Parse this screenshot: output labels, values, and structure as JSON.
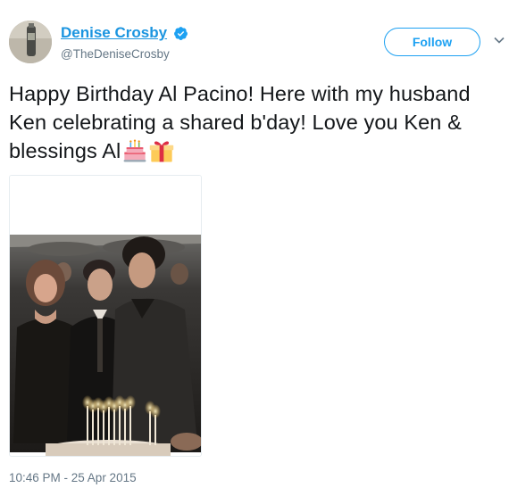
{
  "author": {
    "name": "Denise Crosby",
    "handle": "@TheDeniseCrosby",
    "verified": true
  },
  "follow_label": "Follow",
  "tweet": {
    "text": "Happy Birthday Al Pacino! Here with my husband Ken celebrating a shared b'day! Love you Ken & blessings Al",
    "emojis": [
      "birthday-cake-icon",
      "gift-icon"
    ]
  },
  "timestamp": "10:46 PM - 25 Apr 2015",
  "colors": {
    "accent": "#1da1f2",
    "name_link": "#1b95e0",
    "secondary_text": "#657786",
    "text": "#14171a"
  }
}
